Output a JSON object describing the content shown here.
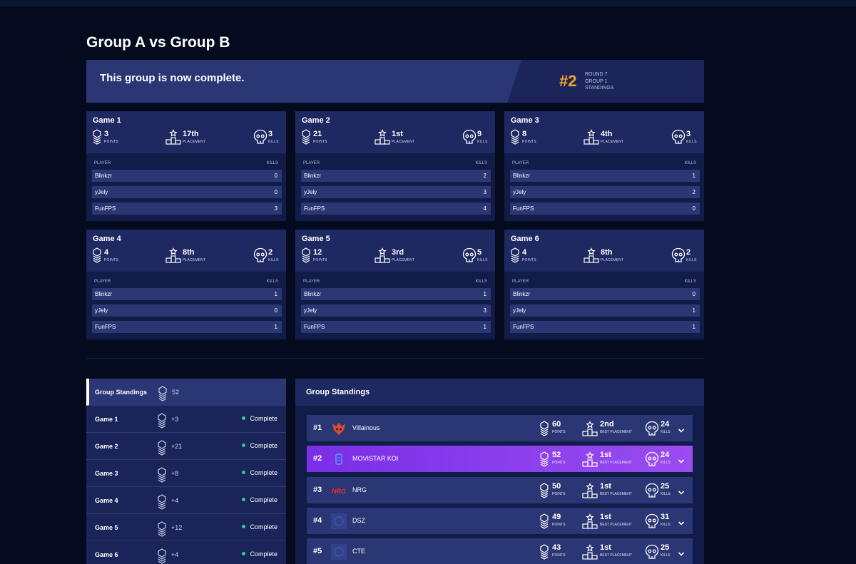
{
  "page": {
    "title": "Group A vs Group B"
  },
  "banner": {
    "message": "This group is now complete.",
    "rank": "#2",
    "meta": [
      "ROUND 7",
      "GROUP 1",
      "STANDINGS"
    ]
  },
  "labels": {
    "points": "POINTS",
    "placement": "PLACEMENT",
    "kills": "KILLS",
    "player": "PLAYER",
    "best_placement": "BEST PLACEMENT"
  },
  "games": [
    {
      "title": "Game 1",
      "points": "3",
      "placement": "17th",
      "kills": "3",
      "players": [
        {
          "name": "Blinkzr",
          "kills": "0"
        },
        {
          "name": "yJely",
          "kills": "0"
        },
        {
          "name": "FunFPS",
          "kills": "3"
        }
      ]
    },
    {
      "title": "Game 2",
      "points": "21",
      "placement": "1st",
      "kills": "9",
      "players": [
        {
          "name": "Blinkzr",
          "kills": "2"
        },
        {
          "name": "yJely",
          "kills": "3"
        },
        {
          "name": "FunFPS",
          "kills": "4"
        }
      ]
    },
    {
      "title": "Game 3",
      "points": "8",
      "placement": "4th",
      "kills": "3",
      "players": [
        {
          "name": "Blinkzr",
          "kills": "1"
        },
        {
          "name": "yJely",
          "kills": "2"
        },
        {
          "name": "FunFPS",
          "kills": "0"
        }
      ]
    },
    {
      "title": "Game 4",
      "points": "4",
      "placement": "8th",
      "kills": "2",
      "players": [
        {
          "name": "Blinkzr",
          "kills": "1"
        },
        {
          "name": "yJely",
          "kills": "0"
        },
        {
          "name": "FunFPS",
          "kills": "1"
        }
      ]
    },
    {
      "title": "Game 5",
      "points": "12",
      "placement": "3rd",
      "kills": "5",
      "players": [
        {
          "name": "Blinkzr",
          "kills": "1"
        },
        {
          "name": "yJely",
          "kills": "3"
        },
        {
          "name": "FunFPS",
          "kills": "1"
        }
      ]
    },
    {
      "title": "Game 6",
      "points": "4",
      "placement": "8th",
      "kills": "2",
      "players": [
        {
          "name": "Blinkzr",
          "kills": "0"
        },
        {
          "name": "yJely",
          "kills": "1"
        },
        {
          "name": "FunFPS",
          "kills": "1"
        }
      ]
    }
  ],
  "sidebar": [
    {
      "label": "Group Standings",
      "points": "52",
      "status": ""
    },
    {
      "label": "Game 1",
      "points": "+3",
      "status": "Complete"
    },
    {
      "label": "Game 2",
      "points": "+21",
      "status": "Complete"
    },
    {
      "label": "Game 3",
      "points": "+8",
      "status": "Complete"
    },
    {
      "label": "Game 4",
      "points": "+4",
      "status": "Complete"
    },
    {
      "label": "Game 5",
      "points": "+12",
      "status": "Complete"
    },
    {
      "label": "Game 6",
      "points": "+4",
      "status": "Complete"
    }
  ],
  "standings": {
    "title": "Group Standings",
    "teams": [
      {
        "rank": "#1",
        "name": "Villainous",
        "points": "60",
        "best_placement": "2nd",
        "kills": "24",
        "logo": "villainous-logo-icon",
        "highlight": false
      },
      {
        "rank": "#2",
        "name": "MOVISTAR KOI",
        "points": "52",
        "best_placement": "1st",
        "kills": "24",
        "logo": "koi-logo-icon",
        "highlight": true
      },
      {
        "rank": "#3",
        "name": "NRG",
        "points": "50",
        "best_placement": "1st",
        "kills": "25",
        "logo": "nrg-logo-icon",
        "highlight": false
      },
      {
        "rank": "#4",
        "name": "DSZ",
        "points": "49",
        "best_placement": "1st",
        "kills": "31",
        "logo": "dsz-logo-icon",
        "highlight": false
      },
      {
        "rank": "#5",
        "name": "CTE",
        "points": "43",
        "best_placement": "1st",
        "kills": "25",
        "logo": "cte-logo-icon",
        "highlight": false
      }
    ]
  },
  "colors": {
    "accent_gold": "#f5a623",
    "status_complete": "#2ecf8a",
    "highlight_purple": "#7a2ee6"
  }
}
